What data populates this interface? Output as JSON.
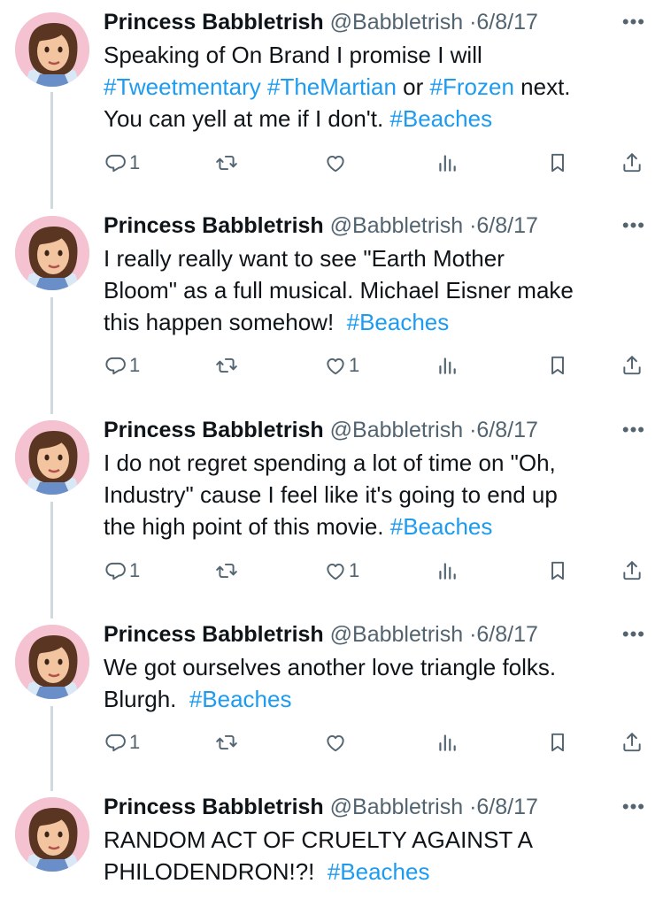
{
  "tweets": [
    {
      "name": "Princess Babbletrish",
      "handle": "@Babbletrish",
      "date": "6/8/17",
      "segments": [
        {
          "t": "Speaking of On Brand I promise I will\n"
        },
        {
          "t": "#Tweetmentary",
          "tag": true
        },
        {
          "t": " "
        },
        {
          "t": "#TheMartian",
          "tag": true
        },
        {
          "t": " or "
        },
        {
          "t": "#Frozen",
          "tag": true
        },
        {
          "t": " next.\nYou can yell at me if I don't. "
        },
        {
          "t": "#Beaches",
          "tag": true
        }
      ],
      "replies": "1",
      "retweets": "",
      "likes": ""
    },
    {
      "name": "Princess Babbletrish",
      "handle": "@Babbletrish",
      "date": "6/8/17",
      "segments": [
        {
          "t": "I really really want to see \"Earth Mother\nBloom\" as a full musical. Michael Eisner make\nthis happen somehow!  "
        },
        {
          "t": "#Beaches",
          "tag": true
        }
      ],
      "replies": "1",
      "retweets": "",
      "likes": "1"
    },
    {
      "name": "Princess Babbletrish",
      "handle": "@Babbletrish",
      "date": "6/8/17",
      "segments": [
        {
          "t": "I do not regret spending a lot of time on \"Oh,\nIndustry\" cause I feel like it's going to end up\nthe high point of this movie. "
        },
        {
          "t": "#Beaches",
          "tag": true
        }
      ],
      "replies": "1",
      "retweets": "",
      "likes": "1"
    },
    {
      "name": "Princess Babbletrish",
      "handle": "@Babbletrish",
      "date": "6/8/17",
      "segments": [
        {
          "t": "We got ourselves another love triangle folks.\nBlurgh.  "
        },
        {
          "t": "#Beaches",
          "tag": true
        }
      ],
      "replies": "1",
      "retweets": "",
      "likes": ""
    },
    {
      "name": "Princess Babbletrish",
      "handle": "@Babbletrish",
      "date": "6/8/17",
      "segments": [
        {
          "t": "RANDOM ACT OF CRUELTY AGAINST A\nPHILODENDRON!?!  "
        },
        {
          "t": "#Beaches",
          "tag": true
        }
      ],
      "replies": "",
      "retweets": "",
      "likes": ""
    }
  ],
  "icons": {
    "reply": "reply-icon",
    "retweet": "retweet-icon",
    "like": "like-icon",
    "views": "views-icon",
    "bookmark": "bookmark-icon",
    "share": "share-icon",
    "more": "more-icon"
  },
  "colors": {
    "text": "#0f1419",
    "muted": "#536471",
    "link": "#1d9bf0",
    "thread": "#cfd9de"
  }
}
